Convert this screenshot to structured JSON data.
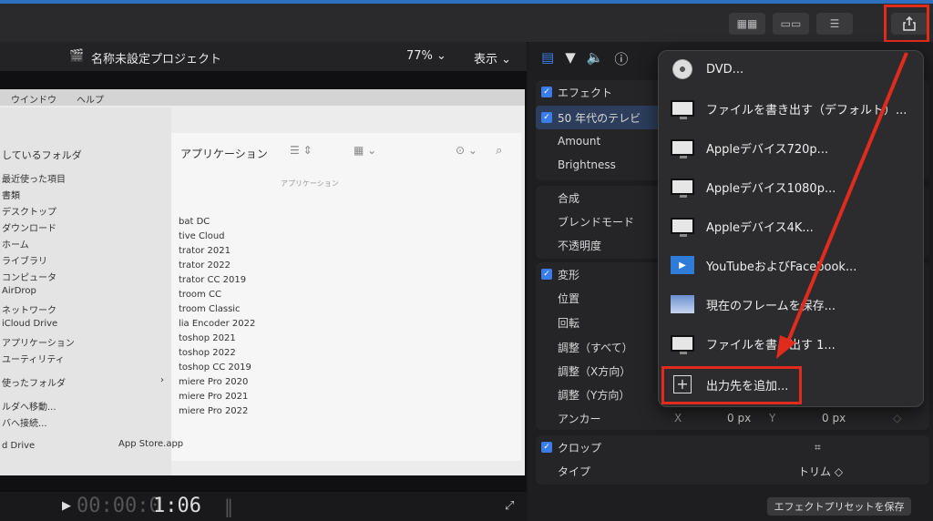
{
  "toolbar": {
    "share_icon": "share-icon",
    "buttons": [
      "grid-view-icon",
      "filmstrip-icon",
      "adjust-icon"
    ]
  },
  "viewer": {
    "project_title": "名称未設定プロジェクト",
    "zoom": "77%",
    "display_menu": "表示",
    "timecode_dim": "00:00:0",
    "timecode": "1:06"
  },
  "finder": {
    "menubar": [
      "ウインドウ",
      "ヘルプ"
    ],
    "window_title": "アプリケーション",
    "section_recent": "しているフォルダ",
    "sidebar": [
      "最近使った項目",
      "書類",
      "デスクトップ",
      "ダウンロード",
      "ホーム",
      "ライブラリ",
      "コンピュータ",
      "AirDrop",
      "ネットワーク",
      "iCloud Drive",
      "アプリケーション",
      "ユーティリティ"
    ],
    "used_folders": "使ったフォルダ",
    "move_to": "ルダへ移動...",
    "connect": "バへ接続...",
    "drive": "d Drive",
    "column_header": "アプリケーション",
    "files": [
      "bat DC",
      "tive Cloud",
      "trator 2021",
      "trator 2022",
      "trator CC 2019",
      "troom CC",
      "troom Classic",
      "lia Encoder 2022",
      "toshop 2021",
      "toshop 2022",
      "toshop CC 2019",
      "miere Pro 2020",
      "miere Pro 2021",
      "miere Pro 2022"
    ],
    "appstore": "App Store.app"
  },
  "inspector": {
    "tabs": [
      "film-icon",
      "filter-icon",
      "audio-icon",
      "info-icon"
    ],
    "effects": "エフェクト",
    "tv_effect": "50 年代のテレビ",
    "amount": "Amount",
    "brightness": "Brightness",
    "composite": "合成",
    "blend_mode": "ブレンドモード",
    "opacity": "不透明度",
    "transform": "変形",
    "position": "位置",
    "rotation": "回転",
    "scale_all": "調整（すべて）",
    "scale_x": "調整（X方向）",
    "scale_y": "調整（Y方向）",
    "anchor": "アンカー",
    "anchor_x_label": "X",
    "anchor_x": "0 px",
    "anchor_y_label": "Y",
    "anchor_y": "0 px",
    "crop": "クロップ",
    "type_label": "タイプ",
    "type_value": "トリム ◇",
    "save_preset": "エフェクトプリセットを保存"
  },
  "share_menu": {
    "items": [
      {
        "label": "DVD...",
        "icon": "dvd-icon"
      },
      {
        "label": "ファイルを書き出す（デフォルト）...",
        "icon": "monitor-icon"
      },
      {
        "label": "Appleデバイス720p...",
        "icon": "monitor-icon"
      },
      {
        "label": "Appleデバイス1080p...",
        "icon": "monitor-icon"
      },
      {
        "label": "Appleデバイス4K...",
        "icon": "monitor-icon"
      },
      {
        "label": "YouTubeおよびFacebook...",
        "icon": "film-strip-icon"
      },
      {
        "label": "現在のフレームを保存...",
        "icon": "photo-icon"
      },
      {
        "label": "ファイルを書き出す 1...",
        "icon": "monitor-icon"
      },
      {
        "label": "出力先を追加...",
        "icon": "plus-icon"
      }
    ]
  },
  "colors": {
    "accent": "#3b7de8",
    "highlight": "#e02b1d"
  }
}
